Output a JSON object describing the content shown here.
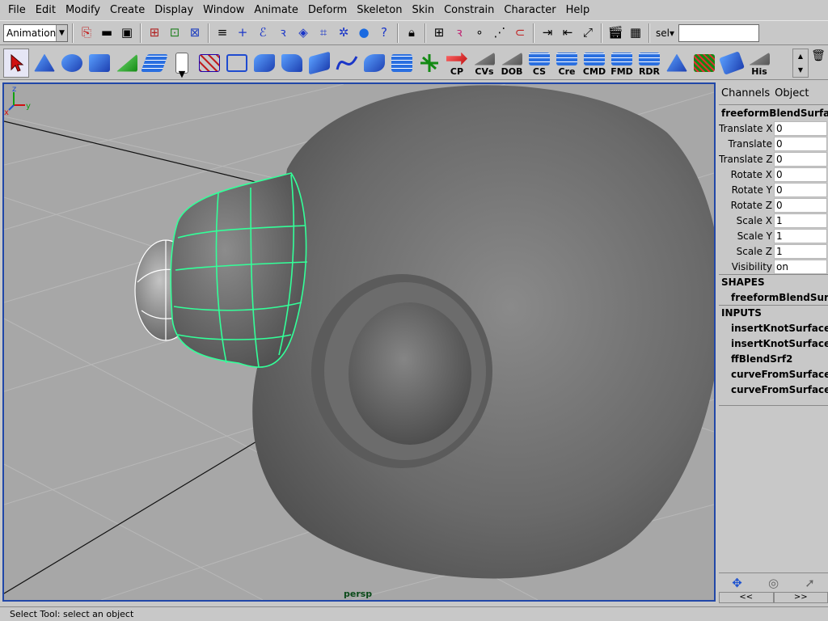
{
  "menubar": [
    "File",
    "Edit",
    "Modify",
    "Create",
    "Display",
    "Window",
    "Animate",
    "Deform",
    "Skeleton",
    "Skin",
    "Constrain",
    "Character",
    "Help"
  ],
  "statusline": {
    "mode": "Animation",
    "sel_label": "sel▾",
    "sel_value": ""
  },
  "shelf": {
    "labels": [
      "CP",
      "CVs",
      "DOB",
      "CS",
      "Cre",
      "CMD",
      "FMD",
      "RDR",
      "His"
    ]
  },
  "viewport": {
    "camera": "persp",
    "axis_x": "x",
    "axis_y": "y",
    "axis_z": "z"
  },
  "channelbox": {
    "tab_channels": "Channels",
    "tab_object": "Object",
    "object_name": "freeformBlendSurfa",
    "attributes": [
      {
        "label": "Translate X",
        "value": "0"
      },
      {
        "label": "Translate",
        "value": "0"
      },
      {
        "label": "Translate Z",
        "value": "0"
      },
      {
        "label": "Rotate X",
        "value": "0"
      },
      {
        "label": "Rotate Y",
        "value": "0"
      },
      {
        "label": "Rotate Z",
        "value": "0"
      },
      {
        "label": "Scale X",
        "value": "1"
      },
      {
        "label": "Scale Y",
        "value": "1"
      },
      {
        "label": "Scale Z",
        "value": "1"
      },
      {
        "label": "Visibility",
        "value": "on"
      }
    ],
    "shapes_header": "SHAPES",
    "shapes": [
      "freeformBlendSurf"
    ],
    "inputs_header": "INPUTS",
    "inputs": [
      "insertKnotSurface",
      "insertKnotSurface",
      "ffBlendSrf2",
      "curveFromSurface",
      "curveFromSurface"
    ],
    "scroll_left": "<<",
    "scroll_right": ">>"
  },
  "helpline": "Select Tool: select an object"
}
